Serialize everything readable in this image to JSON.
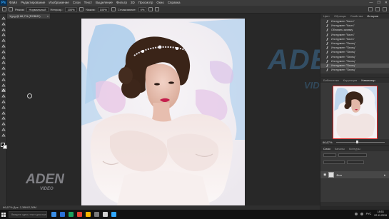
{
  "app": {
    "logo": "Ps",
    "menu": [
      "Файл",
      "Редактирование",
      "Изображение",
      "Слои",
      "Текст",
      "Выделение",
      "Фильтр",
      "3D",
      "Просмотр",
      "Окно",
      "Справка"
    ],
    "window_controls": [
      "—",
      "❐",
      "✕"
    ]
  },
  "options_bar": {
    "mode_label": "Режим:",
    "mode_value": "Нормальный",
    "opacity_label": "Непрозр.:",
    "opacity_value": "100%",
    "flow_label": "Нажим:",
    "flow_value": "100%",
    "smoothing_label": "Сглаживание:",
    "smoothing_value": "0%"
  },
  "document": {
    "tab_title": "1.jpg @ 66,7% (RGB/8*)",
    "zoom_status": "66,67%   Док: 2,38M/2,38M"
  },
  "watermarks": {
    "big": "ADEN",
    "big_sub": "VIDEO",
    "small": "ADEN",
    "small_sub": "VIDEO"
  },
  "history_panel": {
    "tabs": [
      "Цвет",
      "Образцы",
      "Свойства",
      "История"
    ],
    "active_tab": "История",
    "items": [
      "Инструмент \"Кисть\"",
      "Инструмент \"Кисть\"",
      "Обновить заливку",
      "Инструмент \"Кисть\"",
      "Инструмент \"Кисть\"",
      "Инструмент \"Палец\"",
      "Инструмент \"Палец\"",
      "Инструмент \"Палец\"",
      "Инструмент \"Палец\"",
      "Инструмент \"Палец\"",
      "Инструмент \"Палец\"",
      "Инструмент \"Палец\""
    ],
    "selected_index": 10
  },
  "navigator_panel": {
    "tabs": [
      "Библиотеки",
      "Коррекция",
      "Навигатор"
    ],
    "active_tab": "Навигатор",
    "zoom": "66,67%"
  },
  "layers_panel": {
    "tabs": [
      "Слои",
      "Каналы",
      "Контуры"
    ],
    "active_tab": "Слои",
    "layer_name": "Фон"
  },
  "taskbar": {
    "search_placeholder": "Введите здесь текст для поиска",
    "language": "РУС",
    "time": "18:53",
    "date": "22.11.2019",
    "app_colors": [
      "#3a8ee6",
      "#2a6fd6",
      "#1aa260",
      "#e34133",
      "#f7b500",
      "#7a7a7a",
      "#d0d0d0",
      "#31a8ff"
    ]
  },
  "colors": {
    "accent": "#31a8ff",
    "panel_bg": "#383838",
    "canvas_bg": "#282828",
    "watermark_blue": "#3c6e96"
  }
}
